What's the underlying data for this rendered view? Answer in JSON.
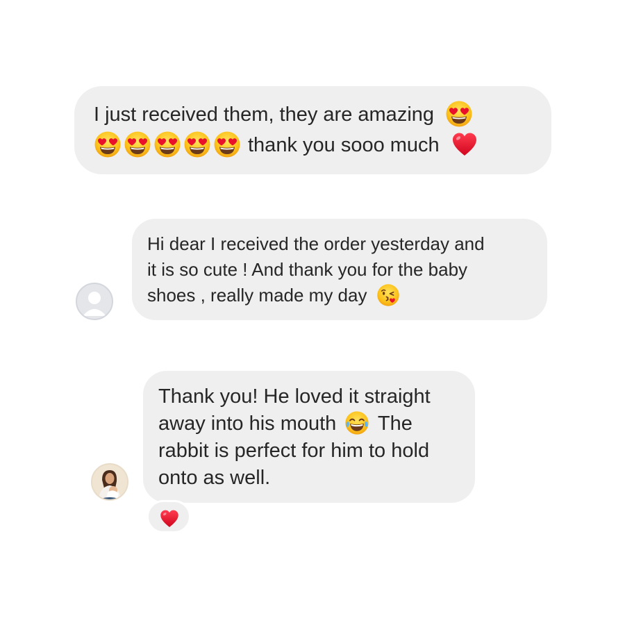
{
  "conversation": {
    "messages": [
      {
        "lines": [
          "I just received them, they are amazing",
          "thank you sooo much"
        ],
        "emojis": [
          "heart-eyes-face",
          "heart-eyes-face",
          "heart-eyes-face",
          "heart-eyes-face",
          "heart-eyes-face",
          "heart-eyes-face",
          "red-heart"
        ]
      },
      {
        "lines": [
          "Hi dear I received the order yesterday and",
          "it is so cute ! And thank you for the baby",
          "shoes , really made my day"
        ],
        "emojis": [
          "face-blowing-kiss"
        ]
      },
      {
        "lines": [
          "Thank you! He loved it straight",
          "away into his mouth",
          "The",
          "rabbit is perfect for him to hold",
          "onto as well."
        ],
        "emojis": [
          "tears-of-joy-face"
        ],
        "reaction": "red-heart"
      }
    ]
  },
  "colors": {
    "bubble": "#efefef",
    "text": "#262626",
    "background": "#ffffff",
    "heart": "#e8102a",
    "emoji_face": "#fcc21b"
  }
}
